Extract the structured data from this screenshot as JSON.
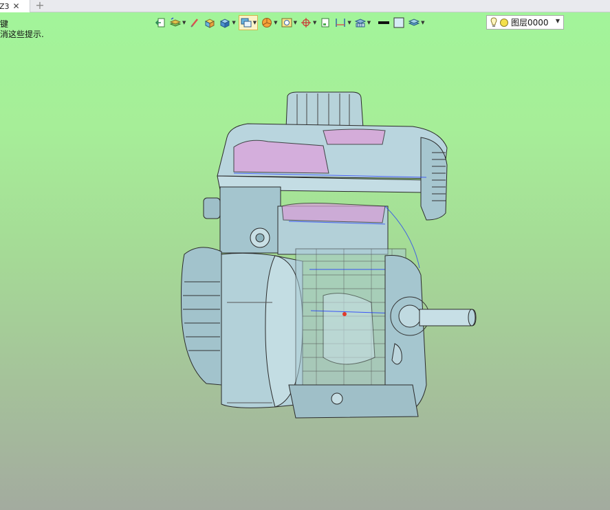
{
  "tab": {
    "label": "Z3",
    "close": "✕",
    "add": "+"
  },
  "hints": [
    "键",
    "消这些提示."
  ],
  "toolbar": {
    "layer_label": "图层0000",
    "active_tool": "display-mode"
  },
  "colors": {
    "bg_top": "#a2f59a",
    "bg_bottom": "#a3ab9f",
    "model_body": "#a9cbd3",
    "model_pink": "#d8a0d8",
    "model_edge": "#2a2a2a",
    "model_highlight": "#1a33ff"
  }
}
